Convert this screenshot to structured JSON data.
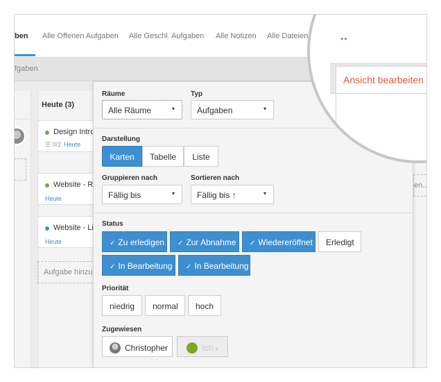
{
  "tabs": [
    {
      "label": "ben",
      "active": true
    },
    {
      "label": "Alle Offenen Aufgaben",
      "active": false
    },
    {
      "label": "Alle Geschl. Aufgaben",
      "active": false
    },
    {
      "label": "Alle Notizen",
      "active": false
    },
    {
      "label": "Alle Dateien",
      "active": false
    }
  ],
  "subbar": {
    "text": "fgaben"
  },
  "view_button": {
    "label": "Ansicht bearbeiten",
    "chevron": "chevron-down-icon",
    "more": "••"
  },
  "board": {
    "today_column": {
      "title": "Heute (3)",
      "cards": [
        {
          "title": "Design Intro",
          "dot_color": "#6aa84f",
          "count": "0/2",
          "due": "Heute"
        },
        {
          "title": "Website - R",
          "dot_color": "#6aa84f",
          "due": "Heute"
        },
        {
          "title": "Website - Li",
          "dot_color": "#3a8fd6",
          "due": "Heute"
        }
      ],
      "add_task": "Aufgabe hinzu"
    },
    "right_column_text": "en..."
  },
  "filter_panel": {
    "rooms": {
      "label": "Räume",
      "value": "Alle Räume"
    },
    "type": {
      "label": "Typ",
      "value": "Aufgaben"
    },
    "display": {
      "label": "Darstellung",
      "options": [
        "Karten",
        "Tabelle",
        "Liste"
      ],
      "selected": "Karten"
    },
    "group_by": {
      "label": "Gruppieren nach",
      "value": "Fällig bis"
    },
    "sort_by": {
      "label": "Sortieren nach",
      "value": "Fällig bis ↑"
    },
    "status": {
      "label": "Status",
      "options": [
        {
          "label": "Zu erledigen",
          "checked": true
        },
        {
          "label": "Zur Abnahme",
          "checked": true
        },
        {
          "label": "Wiedereröffnet",
          "checked": true
        },
        {
          "label": "Erledigt",
          "checked": false
        },
        {
          "label": "In Bearbeitung",
          "checked": true
        },
        {
          "label": "In Bearbeitung",
          "checked": true
        }
      ],
      "check_glyph": "✓"
    },
    "priority": {
      "label": "Priorität",
      "options": [
        "niedrig",
        "normal",
        "hoch"
      ]
    },
    "assigned": {
      "label": "Zugewiesen",
      "people": [
        {
          "name": "Christopher"
        },
        {
          "name": "Ich"
        }
      ]
    }
  },
  "colors": {
    "accent": "#3d8fd1",
    "highlight": "#e05a3a",
    "ok": "#7aa81e"
  }
}
